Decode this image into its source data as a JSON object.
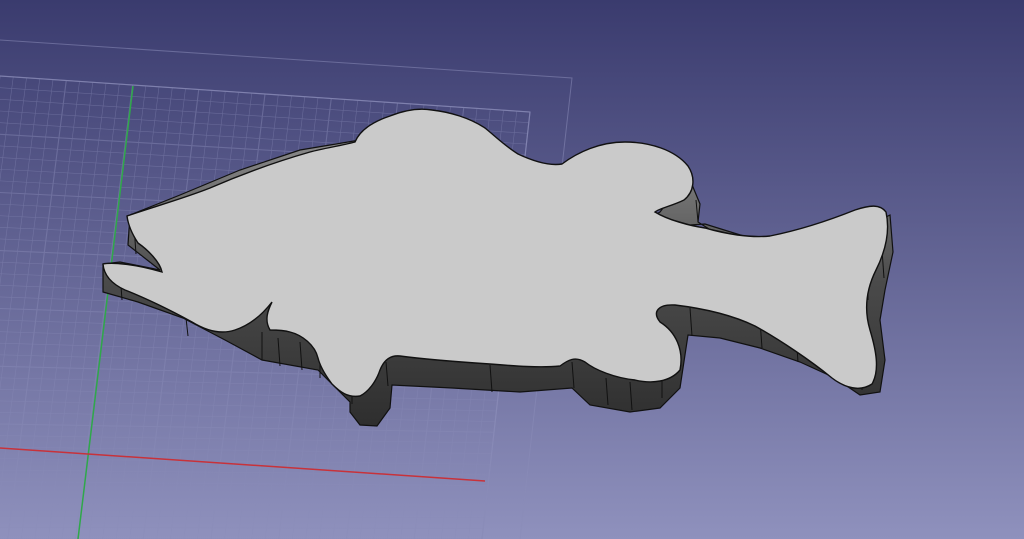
{
  "viewport": {
    "background_top": "#3a3b6e",
    "background_bottom": "#8f91bd"
  },
  "grid": {
    "line_color": "#8a8cb8",
    "x_axis_color": "#c8323a",
    "y_axis_color": "#2fa84a"
  },
  "part": {
    "top_face_color": "#cacaca",
    "side_face_color": "#5c5c5c",
    "edge_color": "#111111"
  }
}
